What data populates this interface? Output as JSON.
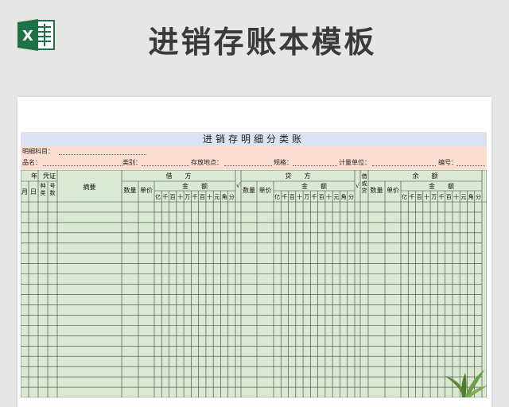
{
  "page": {
    "title": "进销存账本模板",
    "excel_icon_letter": "X"
  },
  "sheet": {
    "title": "进销存明细分类账",
    "meta_row1": {
      "subject_label": "明细科目："
    },
    "meta_row2": {
      "name_label": "品名：",
      "category_label": "类别：",
      "location_label": "存放地点：",
      "spec_label": "规格：",
      "unit_label": "计量单位：",
      "number_label": "编号："
    },
    "headers": {
      "year": "年",
      "month": "月",
      "day": "日",
      "voucher": "凭证",
      "voucher_type": "种类",
      "voucher_number": "号数",
      "summary": "摘要",
      "debit": "借　　方",
      "credit": "贷　　方",
      "balance": "余　　额",
      "direction": "借或贷",
      "quantity": "数量",
      "unit_price": "单价",
      "amount": "金　　额",
      "check": "√",
      "digits": [
        "亿",
        "千",
        "百",
        "十",
        "万",
        "千",
        "百",
        "十",
        "元",
        "角",
        "分"
      ]
    },
    "body_rows": 19,
    "colors": {
      "title_bg": "#dbe3f2",
      "meta_bg": "#fbded0",
      "grid_bg": "#dbe8d2",
      "grid_line": "#404040"
    }
  }
}
